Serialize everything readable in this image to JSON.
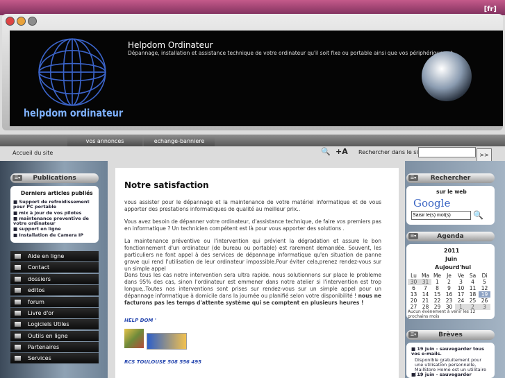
{
  "lang": "[fr]",
  "banner": {
    "logo_text": "helpdom ordinateur",
    "title": "Helpdom Ordinateur",
    "description": "Dépannage, installation et assistance technique de votre ordinateur qu'il soit fixe ou portable ainsi que vos périphériques et internet"
  },
  "nav": [
    "vos annonces",
    "echange-banniere"
  ],
  "breadcrumb": "Accueil du site",
  "search": {
    "label": "Rechercher dans le site",
    "button": ">>"
  },
  "left": {
    "publications_title": "Publications",
    "latest_title": "Derniers articles publiés",
    "latest": [
      "Support de refroidissement pour PC portable",
      "mix à jour de vos pilotes",
      "maintenance preventive de votre ordinateur",
      "support en ligne",
      "Installation de Camera IP"
    ],
    "menu": [
      "Aide en ligne",
      "Contact",
      "dossiers",
      "editos",
      "forum",
      "Livre d'or",
      "Logiciels Utiles",
      "Outils en ligne",
      "Partenaires",
      "Services"
    ]
  },
  "main": {
    "title": "Notre satisfaction",
    "paragraphs": [
      "vous assister pour le dépannage et la maintenance de votre matériel informatique et de vous apporter des prestations informatiques de qualité au meilleur prix..",
      "Vous avez besoin de dépanner votre ordinateur, d'assistance technique, de faire vos premiers pas en informatique ? Un technicien compétent est là pour vous apporter des solutions .",
      "La maintenance préventive ou l'intervention qui prévient la dégradation et assure le bon fonctionnement d'un ordinateur (de bureau ou portable) est rarement demandée. Souvent, les particuliers ne font appel à des services de dépannage informatique qu'en situation de panne grave qui rend l'utilisation de leur ordinateur impossible.Pour éviter cela,prenez rendez-vous sur un simple appel",
      "Dans tous les cas notre intervention sera ultra rapide. nous solutionnons sur place le probleme dans 95% des cas, sinon l'ordinateur est emmener dans notre atelier si l'intervention est trop longue,.Toutes nos interventions sont prises sur rendez-vous sur un simple appel pour un dépannage informatique à domicile dans la journée ou planifié selon votre disponibilité !"
    ],
    "bold_tail": "nous ne facturons pas les temps d'attente système qui se comptent en plusieurs heures !",
    "signature": "HELP DOM '",
    "rcs": "RCS TOULOUSE 508 556 495"
  },
  "right": {
    "search_title": "Rechercher",
    "web_label": "sur le web",
    "google": "Google",
    "google_placeholder": "Saisir le(s) mot(s)",
    "agenda_title": "Agenda",
    "year": "2011",
    "month": "Juin",
    "today": "Aujourd'hui",
    "days": [
      "Lu",
      "Ma",
      "Me",
      "Je",
      "Ve",
      "Sa",
      "Di"
    ],
    "weeks": [
      [
        "30",
        "31",
        "1",
        "2",
        "3",
        "4",
        "5"
      ],
      [
        "6",
        "7",
        "8",
        "9",
        "10",
        "11",
        "12"
      ],
      [
        "13",
        "14",
        "15",
        "16",
        "17",
        "18",
        "19"
      ],
      [
        "20",
        "21",
        "22",
        "23",
        "24",
        "25",
        "26"
      ],
      [
        "27",
        "28",
        "29",
        "30",
        "1",
        "2",
        "3"
      ]
    ],
    "no_event": "Aucun évènement à venir les 12 prochains mois",
    "breves_title": "Brèves",
    "breves": [
      "19 juin - sauvegarder tous vos e-mails.",
      "Disponible gratuitement pour une utilisation personnelle, MailStore Home est un utilitaire (...)",
      "19 juin - sauvegarder"
    ]
  }
}
